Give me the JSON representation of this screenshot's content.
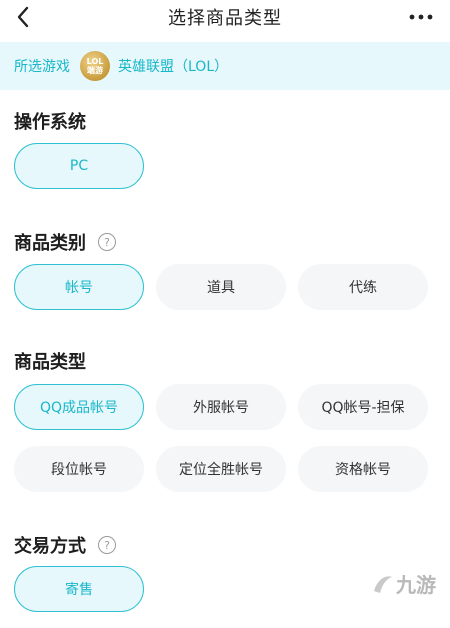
{
  "header": {
    "title": "选择商品类型",
    "more_label": "···"
  },
  "game_bar": {
    "label": "所选游戏",
    "logo_line1": "LOL",
    "logo_line2": "端游",
    "game_name": "英雄联盟（LOL）"
  },
  "sections": {
    "os": {
      "title": "操作系统",
      "options": [
        "PC"
      ]
    },
    "category": {
      "title": "商品类别",
      "help": "?",
      "options": [
        "帐号",
        "道具",
        "代练"
      ]
    },
    "type": {
      "title": "商品类型",
      "options": [
        "QQ成品帐号",
        "外服帐号",
        "QQ帐号-担保",
        "段位帐号",
        "定位全胜帐号",
        "资格帐号"
      ]
    },
    "trade": {
      "title": "交易方式",
      "help": "?",
      "options": [
        "寄售"
      ]
    }
  },
  "watermark": {
    "text": "九游"
  },
  "colors": {
    "accent": "#2fc1d3",
    "accent_bg": "#e6f8fb",
    "chip_bg": "#f4f6f8"
  }
}
